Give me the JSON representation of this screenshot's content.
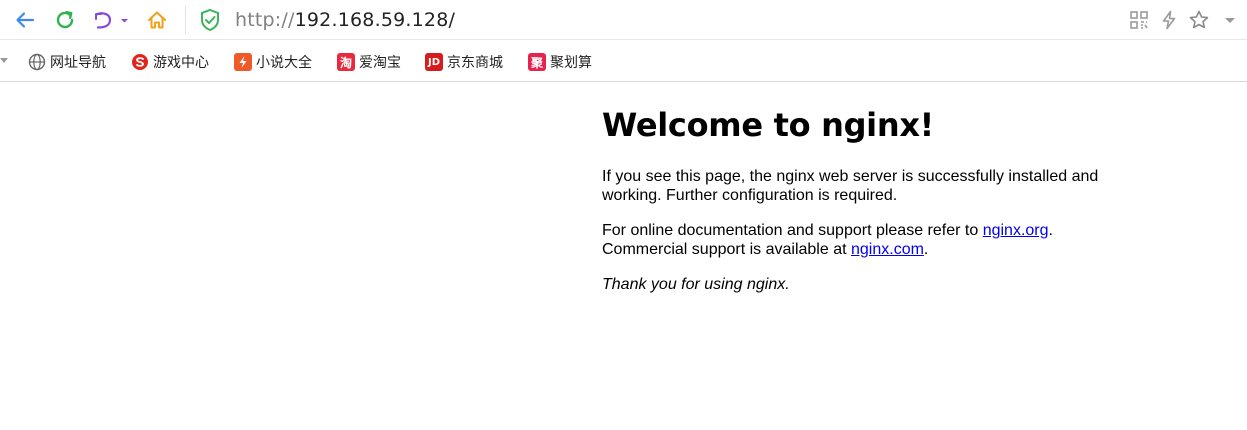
{
  "toolbar": {
    "back": "back-arrow-icon",
    "reload": "reload-icon",
    "undo": "undo-icon",
    "home": "home-icon",
    "security": "shield-check-icon",
    "url_protocol": "http://",
    "url_host": "192.168.59.128/"
  },
  "bookmarks": [
    {
      "label": "网址导航",
      "icon": "globe-icon"
    },
    {
      "label": "游戏中心",
      "icon": "game-logo-icon"
    },
    {
      "label": "小说大全",
      "icon": "novel-logo-icon"
    },
    {
      "label": "爱淘宝",
      "icon": "taobao-logo-icon",
      "glyph": "淘"
    },
    {
      "label": "京东商城",
      "icon": "jd-logo-icon",
      "glyph": "JD"
    },
    {
      "label": "聚划算",
      "icon": "juhuasuan-logo-icon",
      "glyph": "聚"
    }
  ],
  "page": {
    "title": "Welcome to nginx!",
    "para1": "If you see this page, the nginx web server is successfully installed and working. Further configuration is required.",
    "para2_prefix": "For online documentation and support please refer to ",
    "link1": "nginx.org",
    "para2_mid": ".",
    "para2_line2_prefix": "Commercial support is available at ",
    "link2": "nginx.com",
    "para2_suffix": ".",
    "thanks": "Thank you for using nginx."
  },
  "colors": {
    "link": "#0000ee",
    "back_icon": "#3d8be8",
    "reload_icon": "#2fb34a",
    "undo_icon": "#8a4ad8",
    "home_icon": "#f0a21a",
    "shield_icon": "#3db35a"
  }
}
